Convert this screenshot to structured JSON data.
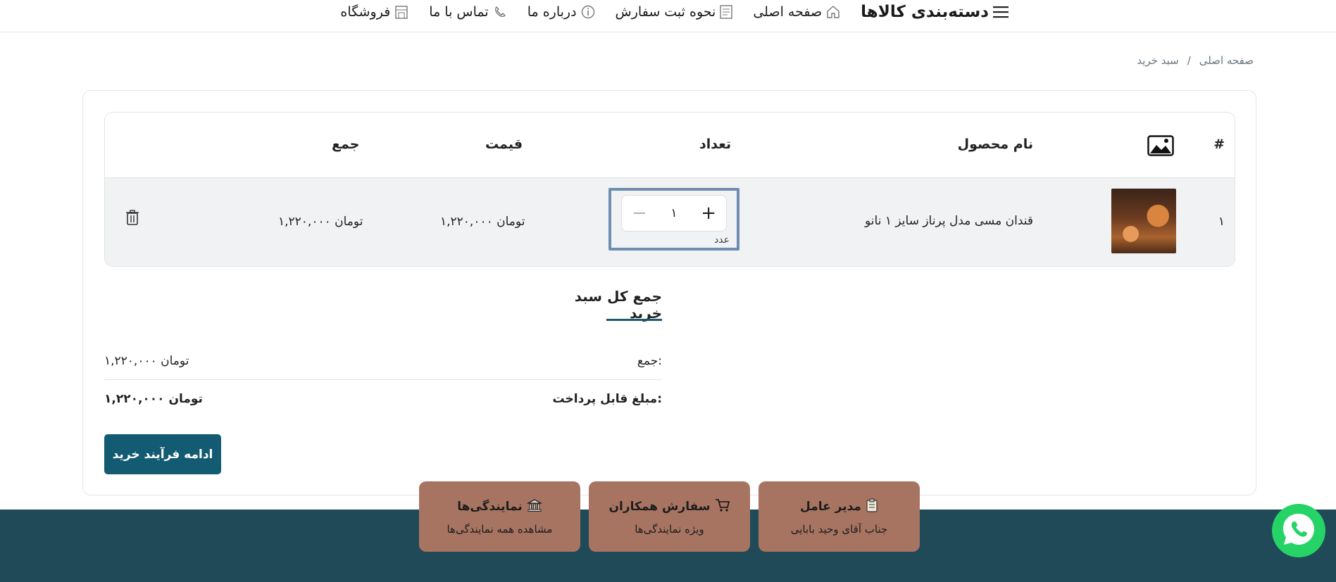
{
  "nav": {
    "categories_label": "دسته‌بندی کالاها",
    "items": [
      {
        "label": "صفحه اصلی",
        "icon": "home-icon"
      },
      {
        "label": "نحوه ثبت سفارش",
        "icon": "document-icon"
      },
      {
        "label": "درباره ما",
        "icon": "info-icon"
      },
      {
        "label": "تماس با ما",
        "icon": "phone-icon"
      },
      {
        "label": "فروشگاه",
        "icon": "store-icon"
      }
    ]
  },
  "breadcrumb": {
    "home": "صفحه اصلی",
    "separator": "/",
    "current": "سبد خرید"
  },
  "table": {
    "headers": {
      "index": "#",
      "image_icon": "image-icon",
      "name": "نام محصول",
      "quantity": "تعداد",
      "price": "قیمت",
      "total": "جمع"
    },
    "rows": [
      {
        "index": "۱",
        "name": "قندان مسی مدل پرناز سایز ۱ نانو",
        "quantity": "۱",
        "unit": "عدد",
        "price": "۱,۲۲۰,۰۰۰ تومان",
        "total": "۱,۲۲۰,۰۰۰ تومان"
      }
    ]
  },
  "totals": {
    "title": "جمع کل سبد خرید",
    "subtotal_label": "جمع:",
    "subtotal_value": "۱,۲۲۰,۰۰۰ تومان",
    "payable_label": "مبلغ قابل پرداخت:",
    "payable_value": "۱,۲۲۰,۰۰۰ تومان"
  },
  "continue_button": "ادامه فرآیند خرید",
  "footer_cards": [
    {
      "title": "مدیر عامل",
      "subtitle": "جناب آقای وحید بابایی",
      "icon": "clipboard-icon"
    },
    {
      "title": "سفارش همکاران",
      "subtitle": "ویژه نمایندگی‌ها",
      "icon": "cart-icon"
    },
    {
      "title": "نمایندگی‌ها",
      "subtitle": "مشاهده همه نمایندگی‌ها",
      "icon": "bank-icon"
    }
  ],
  "colors": {
    "primary_button": "#135b73",
    "footer_bg": "#204a57",
    "footer_card": "#a87462",
    "whatsapp": "#25d366",
    "row_bg": "#f1f2f4"
  }
}
